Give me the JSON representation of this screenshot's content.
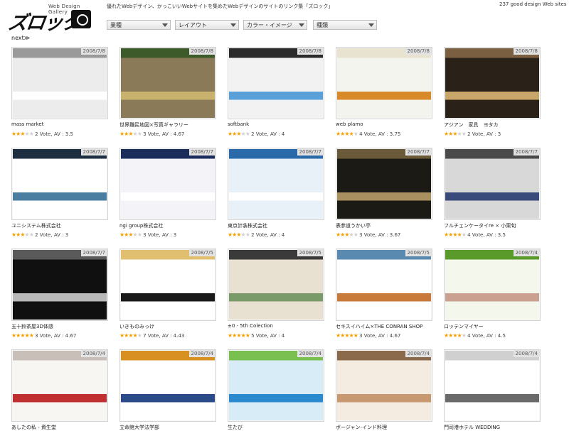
{
  "header": {
    "logo_sub": "Web Design Gallery",
    "logo_main": "ズロック",
    "tagline": "優れたWebデザイン、かっこいいWebサイトを集めたWebデザインのサイトのリンク集「ズロック」",
    "site_count": "237 good design Web sites"
  },
  "filters": [
    {
      "label": "業種"
    },
    {
      "label": "レイアウト"
    },
    {
      "label": "カラー・イメージ"
    },
    {
      "label": "種類"
    }
  ],
  "nav": {
    "next_label": "next≫"
  },
  "items": [
    {
      "title": "mass market",
      "date": "2008/7/8",
      "stars": 3,
      "votes": 2,
      "av": "3.5",
      "colors": [
        "#ececec",
        "#9a9a9a",
        "#ffffff"
      ]
    },
    {
      "title": "世界難民地図×写真ギャラリー",
      "date": "2008/7/8",
      "stars": 3,
      "votes": 3,
      "av": "4.67",
      "colors": [
        "#8a7a58",
        "#3c5a2a",
        "#c8b26e"
      ]
    },
    {
      "title": "softbank",
      "date": "2008/7/8",
      "stars": 3,
      "votes": 2,
      "av": "4",
      "colors": [
        "#f2f2f2",
        "#2b2b2b",
        "#5aa0d8"
      ]
    },
    {
      "title": "web plamo",
      "date": "2008/7/8",
      "stars": 4,
      "votes": 4,
      "av": "3.75",
      "colors": [
        "#f4f4ee",
        "#e8e2d0",
        "#d88a2a"
      ]
    },
    {
      "title": "アジアン　家具　ヨタカ",
      "date": "2008/7/8",
      "stars": 3,
      "votes": 2,
      "av": "3",
      "colors": [
        "#2a2218",
        "#7a6040",
        "#c9a66a"
      ]
    },
    {
      "title": "ユニシステム株式会社",
      "date": "2008/7/7",
      "stars": 3,
      "votes": 2,
      "av": "3",
      "colors": [
        "#ffffff",
        "#1c2e40",
        "#4a7ea0"
      ]
    },
    {
      "title": "ngi group株式会社",
      "date": "2008/7/7",
      "stars": 3,
      "votes": 3,
      "av": "3",
      "colors": [
        "#f4f4f8",
        "#1a2c5a",
        "#ffffff"
      ]
    },
    {
      "title": "東京計装株式会社",
      "date": "2008/7/7",
      "stars": 3,
      "votes": 2,
      "av": "4",
      "colors": [
        "#e8f0f8",
        "#2a6aa8",
        "#ffffff"
      ]
    },
    {
      "title": "表参道うかい亭",
      "date": "2008/7/7",
      "stars": 3,
      "votes": 3,
      "av": "3.67",
      "colors": [
        "#1c1a14",
        "#6a5a3a",
        "#a89060"
      ]
    },
    {
      "title": "フルチェンケータイre × 小栗旬",
      "date": "2008/7/7",
      "stars": 4,
      "votes": 4,
      "av": "3.5",
      "colors": [
        "#d8d8d8",
        "#4a4a4a",
        "#3a4a7a"
      ]
    },
    {
      "title": "五十鈴茶屋3D体感",
      "date": "2008/7/7",
      "stars": 5,
      "votes": 3,
      "av": "4.67",
      "colors": [
        "#101010",
        "#5a5a5a",
        "#b8b8b8"
      ]
    },
    {
      "title": "いきものみっけ",
      "date": "2008/7/5",
      "stars": 4,
      "votes": 7,
      "av": "4.43",
      "colors": [
        "#ffffff",
        "#e0c070",
        "#1a1a1a"
      ]
    },
    {
      "title": "±0 - 5th Colection",
      "date": "2008/7/5",
      "stars": 5,
      "votes": 5,
      "av": "4",
      "colors": [
        "#e8e0d0",
        "#3a3a3a",
        "#7a9a6a"
      ]
    },
    {
      "title": "セキスイハイム×THE CONRAN SHOP",
      "date": "2008/7/5",
      "stars": 5,
      "votes": 3,
      "av": "4.67",
      "colors": [
        "#ffffff",
        "#5a8ab0",
        "#c87a3a"
      ]
    },
    {
      "title": "ロッテンマイヤー",
      "date": "2008/7/4",
      "stars": 4,
      "votes": 4,
      "av": "4.5",
      "colors": [
        "#f4f8ec",
        "#5a9a2a",
        "#caa090"
      ]
    },
    {
      "title": "あしたの私 - 資生堂",
      "date": "2008/7/4",
      "stars": 0,
      "votes": "",
      "av": "",
      "colors": [
        "#f8f6f2",
        "#c8c0b8",
        "#c03030"
      ]
    },
    {
      "title": "立命館大学法学部",
      "date": "2008/7/4",
      "stars": 0,
      "votes": "",
      "av": "",
      "colors": [
        "#ffffff",
        "#d89020",
        "#2a4a8a"
      ]
    },
    {
      "title": "生たび",
      "date": "2008/7/4",
      "stars": 0,
      "votes": "",
      "av": "",
      "colors": [
        "#d8ecf8",
        "#7ac050",
        "#2a8ad0"
      ]
    },
    {
      "title": "ボージャン-インド料理",
      "date": "2008/7/4",
      "stars": 0,
      "votes": "",
      "av": "",
      "colors": [
        "#f4ece0",
        "#8a6a4a",
        "#c89870"
      ]
    },
    {
      "title": "門司港ホテル WEDDING",
      "date": "2008/7/4",
      "stars": 0,
      "votes": "",
      "av": "",
      "colors": [
        "#ffffff",
        "#d0d0d0",
        "#6a6a6a"
      ]
    }
  ]
}
